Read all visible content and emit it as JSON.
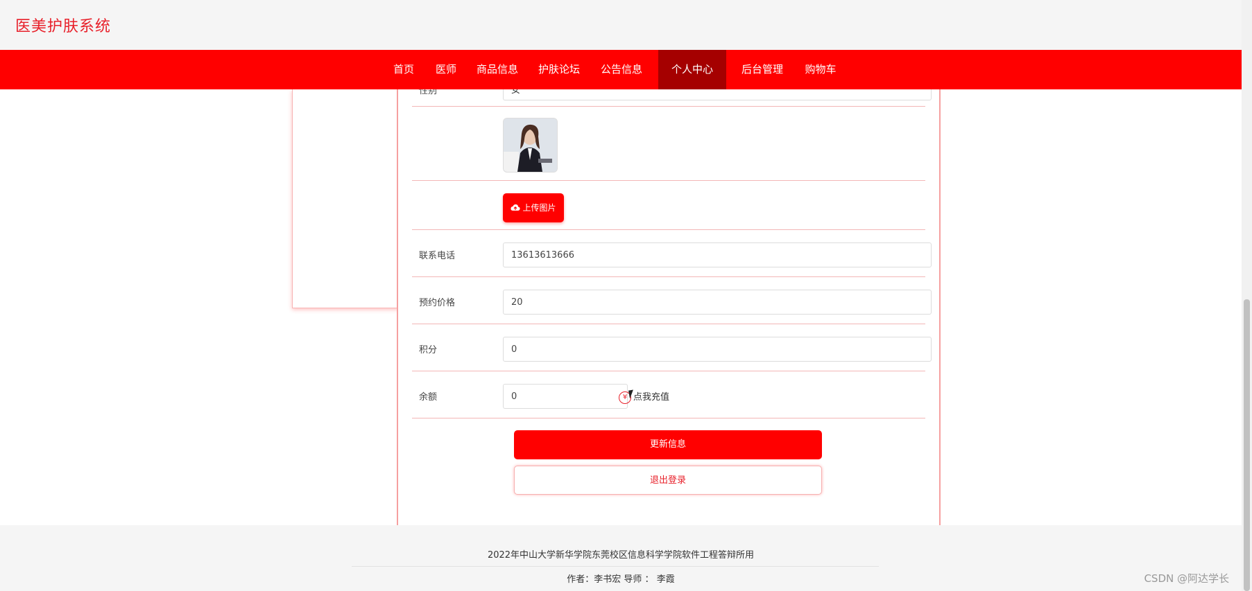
{
  "header": {
    "site_title": "医美护肤系统"
  },
  "nav": {
    "items": [
      {
        "label": "首页"
      },
      {
        "label": "医师"
      },
      {
        "label": "商品信息"
      },
      {
        "label": "护肤论坛"
      },
      {
        "label": "公告信息"
      },
      {
        "label": "个人中心",
        "active": true
      },
      {
        "label": "后台管理"
      },
      {
        "label": "购物车"
      }
    ]
  },
  "form": {
    "partial_row_label": "性别",
    "partial_row_value": "女",
    "upload_label": "上传图片",
    "phone": {
      "label": "联系电话",
      "value": "13613613666"
    },
    "price": {
      "label": "预约价格",
      "value": "20"
    },
    "points": {
      "label": "积分",
      "value": "0"
    },
    "balance": {
      "label": "余额",
      "value": "0"
    },
    "recharge_label": "点我充值",
    "recharge_icon": "¥",
    "update_button": "更新信息",
    "logout_button": "退出登录"
  },
  "footer": {
    "line1": "2022年中山大学新华学院东莞校区信息科学学院软件工程答辩所用",
    "line2": "作者：李书宏 导师 ： 李霞"
  },
  "watermark": "CSDN @阿达学长",
  "colors": {
    "accent": "#ff0000",
    "accent_dark": "#a50000"
  }
}
